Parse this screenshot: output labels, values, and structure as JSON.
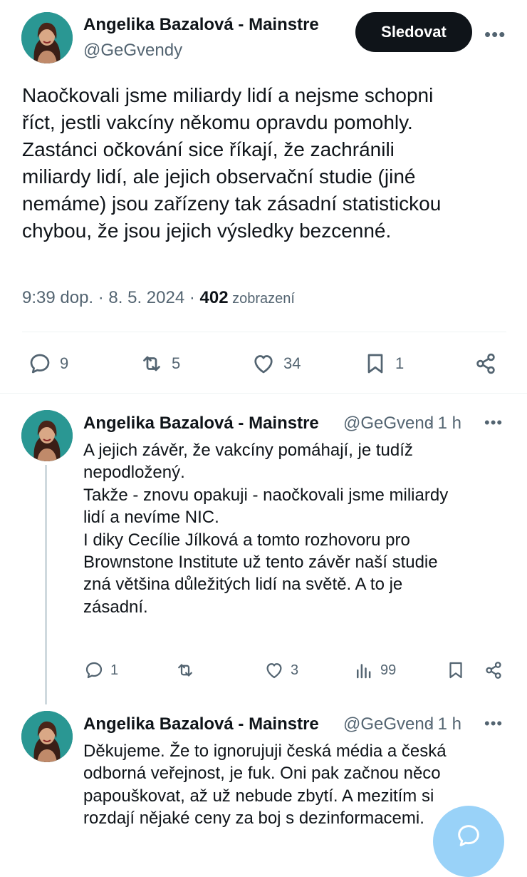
{
  "tweet": {
    "author_name": "Angelika Bazalová - Mainstre",
    "handle": "@GeGvendy",
    "follow_label": "Sledovat",
    "more_label": "•••",
    "text_lines": [
      "Naočkovali jsme miliardy lidí a nejsme schopni",
      "říct, jestli vakcíny někomu opravdu pomohly.",
      "Zastánci očkování sice říkají, že zachránili",
      "miliardy lidí, ale jejich observační studie (jiné",
      "nemáme) jsou zařízeny tak zásadní statistickou",
      "chybou, že jsou jejich výsledky bezcenné."
    ],
    "time": "9:39 dop. · 8. 5. 2024 · ",
    "views": "402",
    "views_label": " zobrazení",
    "stats": {
      "replies": "9",
      "retweets": "5",
      "likes": "34",
      "bookmarks": "1"
    }
  },
  "reply1": {
    "author_name": "Angelika Bazalová - Mainstre",
    "handle": "@GeGvend",
    "time": "· 1 h",
    "more_label": "•••",
    "text_lines": [
      "A jejich závěr, že vakcíny pomáhají, je tudíž",
      "nepodložený.",
      "Takže - znovu opakuji - naočkovali jsme miliardy",
      "lidí a nevíme NIC.",
      "I diky Cecílie Jílková  a tomto rozhovoru pro",
      "Brownstone Institute už tento závěr naší studie",
      "zná většina důležitých lidí na světě. A to je",
      "zásadní."
    ],
    "stats": {
      "replies": "1",
      "retweets": "",
      "likes": "3",
      "views": "99"
    }
  },
  "reply2": {
    "author_name": "Angelika Bazalová - Mainstre",
    "handle": "@GeGvend",
    "time": "· 1 h",
    "more_label": "•••",
    "text_lines": [
      "Děkujeme.  Že to ignorujuji česká média a česká",
      "odborná veřejnost, je fuk. Oni pak začnou něco",
      "papouškovat, až už nebude zbytí. A mezitím si",
      "rozdají nějaké ceny za boj s dezinformacemi."
    ]
  },
  "colors": {
    "text": "#0f1419",
    "secondary": "#536471",
    "accent": "#1d9bf0",
    "divider": "#eff3f4"
  },
  "icons": [
    "reply-icon",
    "retweet-icon",
    "like-icon",
    "bookmark-icon",
    "share-icon",
    "views-icon",
    "compose-icon"
  ]
}
